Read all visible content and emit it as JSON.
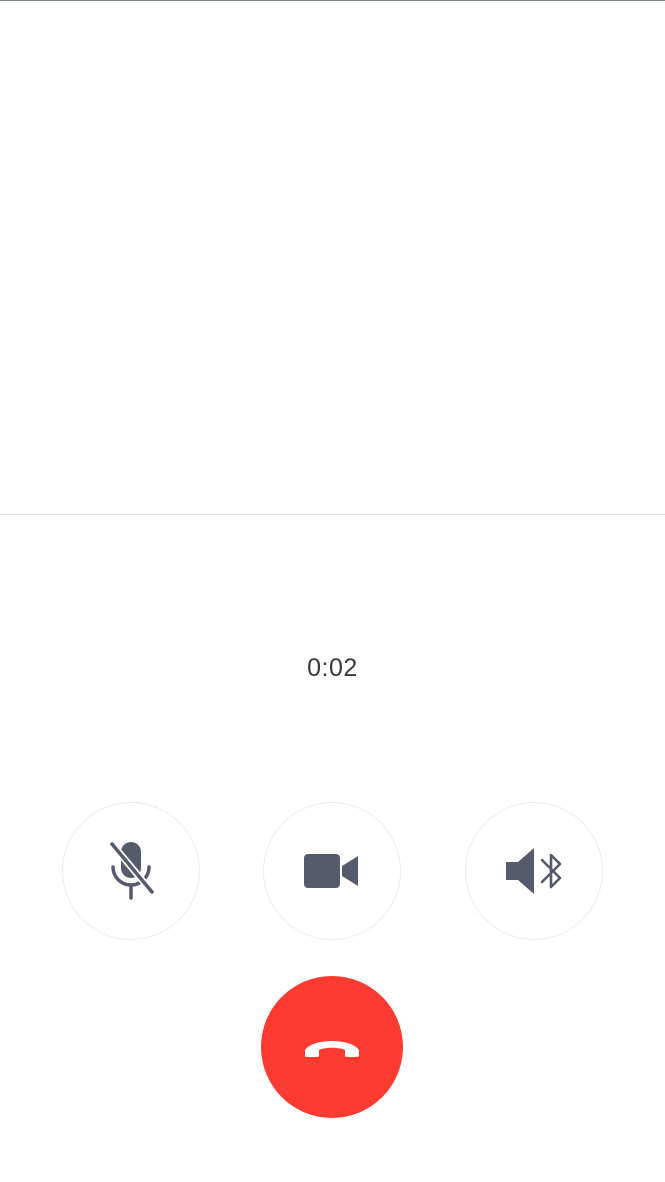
{
  "call": {
    "duration": "0:02"
  },
  "controls": {
    "mute": {
      "icon": "microphone-muted-icon",
      "state": "muted"
    },
    "video": {
      "icon": "video-camera-icon"
    },
    "speaker": {
      "icon": "speaker-bluetooth-icon"
    },
    "end_call": {
      "icon": "phone-hangup-icon"
    }
  },
  "colors": {
    "end_call": "#fe3b30",
    "icon": "#555b6b",
    "button_border": "#ececec",
    "background": "#ffffff"
  }
}
